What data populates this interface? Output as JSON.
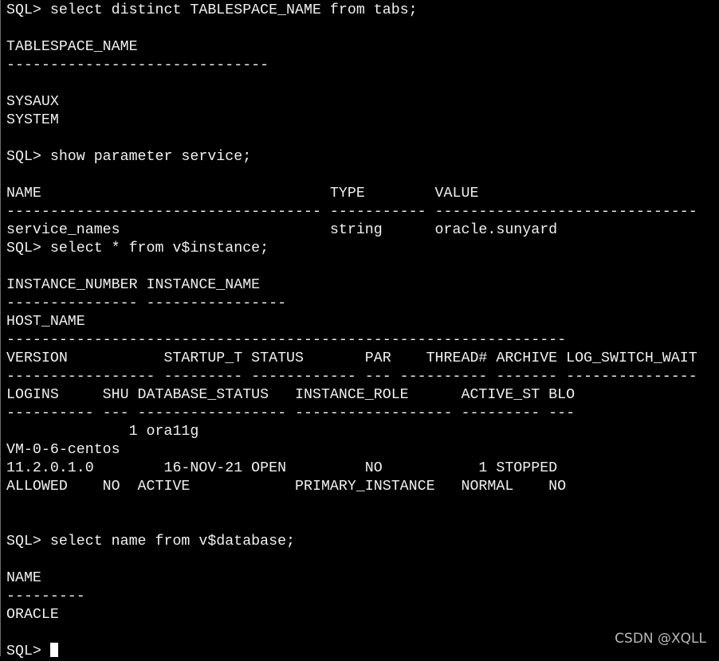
{
  "terminal": {
    "lines": [
      "SQL> select distinct TABLESPACE_NAME from tabs;",
      "",
      "TABLESPACE_NAME",
      "------------------------------",
      "",
      "SYSAUX",
      "SYSTEM",
      "",
      "SQL> show parameter service;",
      "",
      "NAME                                 TYPE        VALUE",
      "------------------------------------ ----------- ------------------------------",
      "service_names                        string      oracle.sunyard",
      "SQL> select * from v$instance;",
      "",
      "INSTANCE_NUMBER INSTANCE_NAME",
      "--------------- ----------------",
      "HOST_NAME",
      "----------------------------------------------------------------",
      "VERSION           STARTUP_T STATUS       PAR    THREAD# ARCHIVE LOG_SWITCH_WAIT",
      "----------------- --------- ------------ --- ---------- ------- ---------------",
      "LOGINS     SHU DATABASE_STATUS   INSTANCE_ROLE      ACTIVE_ST BLO",
      "---------- --- ----------------- ------------------ --------- ---",
      "              1 ora11g",
      "VM-0-6-centos",
      "11.2.0.1.0        16-NOV-21 OPEN         NO           1 STOPPED",
      "ALLOWED    NO  ACTIVE            PRIMARY_INSTANCE   NORMAL    NO",
      "",
      "",
      "SQL> select name from v$database;",
      "",
      "NAME",
      "---------",
      "ORACLE",
      ""
    ],
    "prompt": "SQL> "
  },
  "watermark": "CSDN @XQLL"
}
